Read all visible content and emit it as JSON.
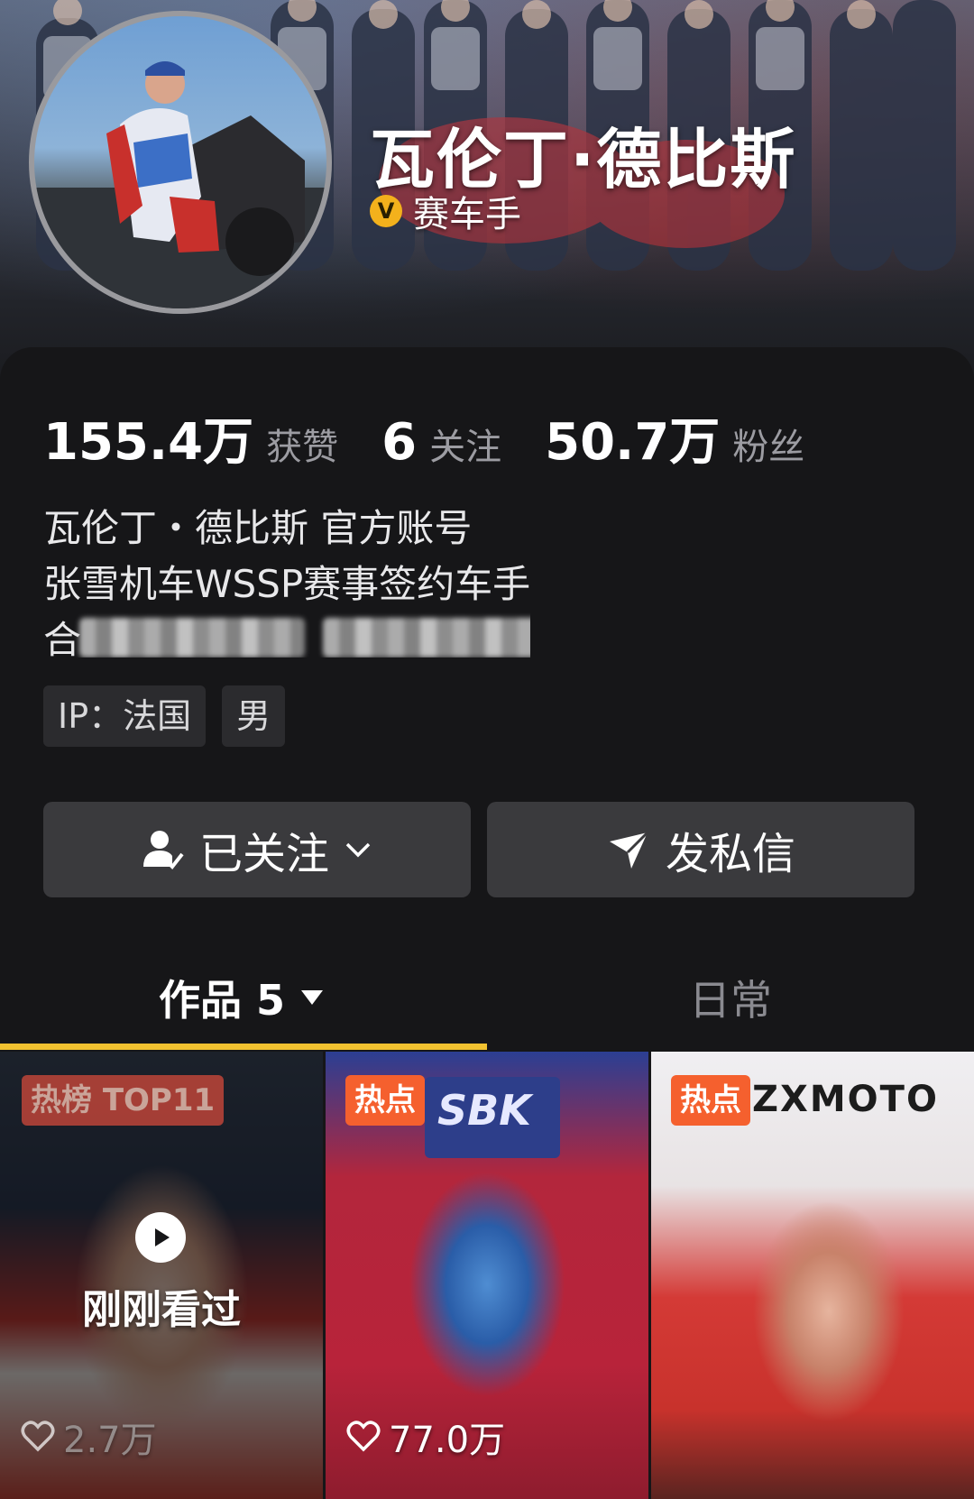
{
  "profile": {
    "display_name": "瓦伦丁·德比斯",
    "verified_label": "赛车手",
    "verified_mark": "V",
    "verified_color": "#f3b11c"
  },
  "stats": [
    {
      "value": "155.4万",
      "label": "获赞"
    },
    {
      "value": "6",
      "label": "关注"
    },
    {
      "value": "50.7万",
      "label": "粉丝"
    }
  ],
  "bio": {
    "line1": "瓦伦丁・德比斯 官方账号",
    "line2": "张雪机车WSSP赛事签约车手",
    "line3_visible_prefix": "合",
    "line3_visible_suffix": "om"
  },
  "tags": {
    "ip": "IP：法国",
    "gender": "男"
  },
  "actions": {
    "follow_label": "已关注",
    "message_label": "发私信"
  },
  "tabs": {
    "works_label": "作品 5",
    "daily_label": "日常",
    "indicator_color": "#f2c230"
  },
  "videos": [
    {
      "badge": "热榜 TOP11",
      "overlay": "刚刚看过",
      "likes": "2.7万"
    },
    {
      "badge": "热点",
      "logo": "SBK",
      "likes": "77.0万"
    },
    {
      "badge": "热点",
      "logo": "ZXMOTO",
      "likes": ""
    }
  ]
}
